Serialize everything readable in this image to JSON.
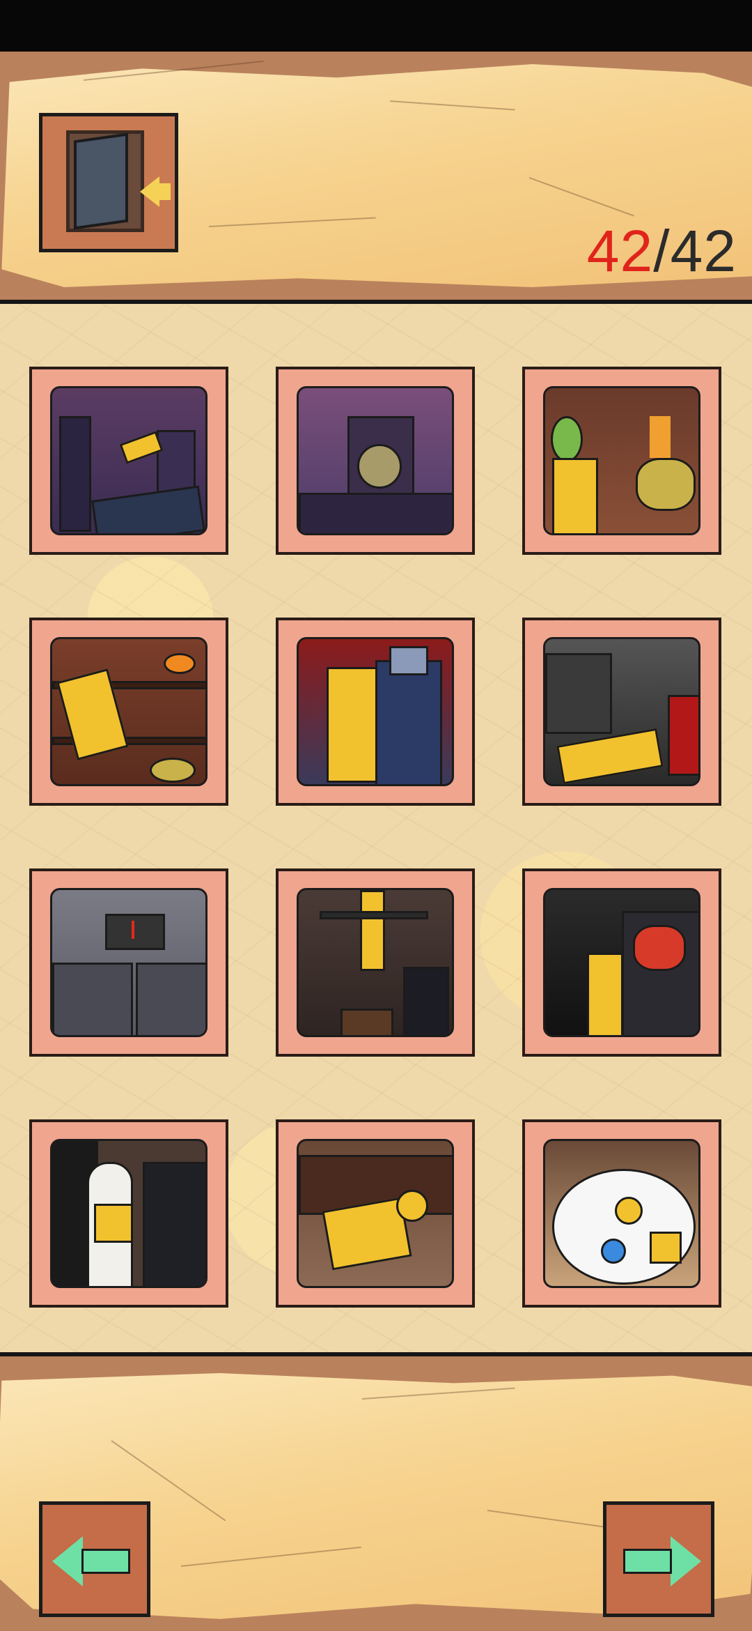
{
  "header": {
    "exit_icon": "exit-door-icon",
    "progress": {
      "current": "42",
      "separator": "/",
      "total": "42"
    }
  },
  "gallery": {
    "cards": [
      {
        "scene": "night-city-rooftop"
      },
      {
        "scene": "clock-tower"
      },
      {
        "scene": "fruit-stall-durian"
      },
      {
        "scene": "shelf-fall"
      },
      {
        "scene": "red-curtain-jiangshi"
      },
      {
        "scene": "stairs-collapse"
      },
      {
        "scene": "elevator-doors"
      },
      {
        "scene": "room-guard-hiding"
      },
      {
        "scene": "angry-guard"
      },
      {
        "scene": "doorway-guard"
      },
      {
        "scene": "crawling-floor"
      },
      {
        "scene": "brawl-cloud"
      }
    ]
  },
  "footer": {
    "prev_icon": "arrow-left-icon",
    "next_icon": "arrow-right-icon"
  },
  "colors": {
    "counter_current": "#e0241b",
    "counter_total": "#2b2b2b",
    "card_frame": "#f0a58e",
    "nav_arrow": "#6ee0a6"
  }
}
